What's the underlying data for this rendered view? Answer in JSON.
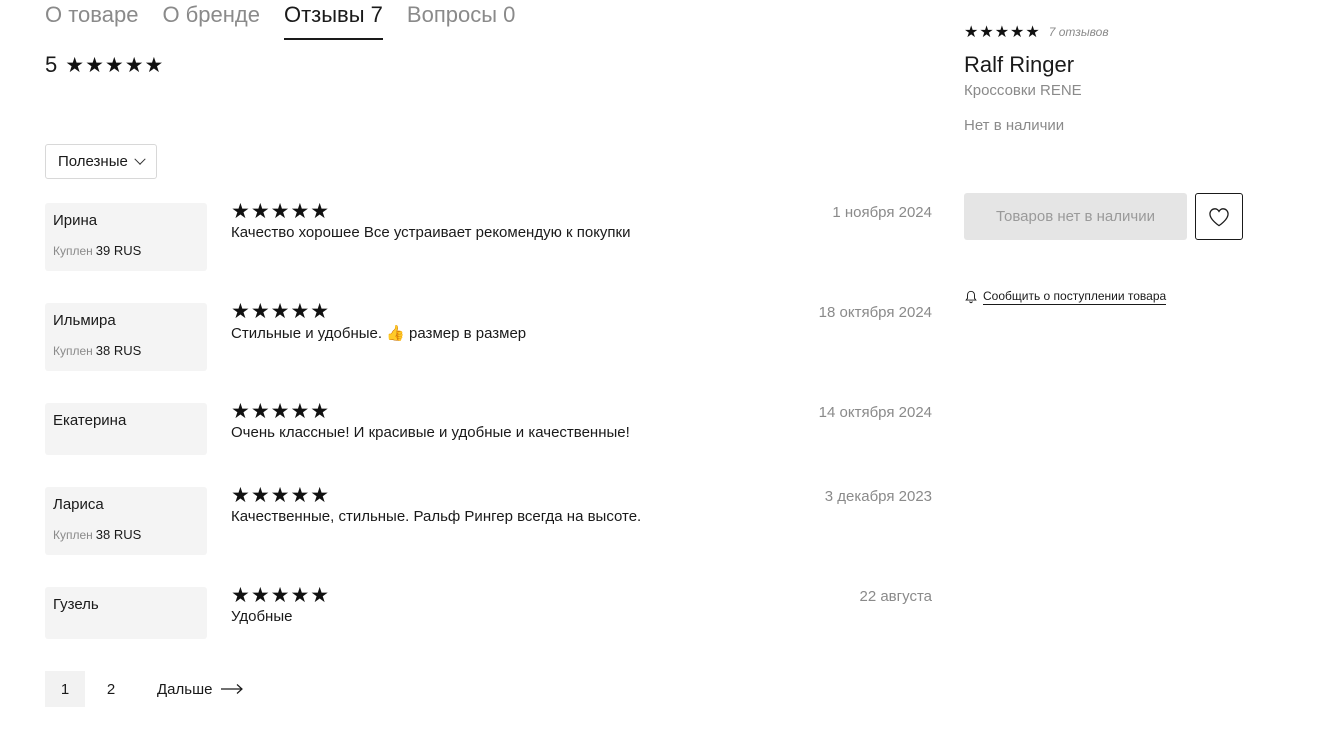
{
  "tabs": [
    {
      "label": "О товаре",
      "active": false
    },
    {
      "label": "О бренде",
      "active": false
    },
    {
      "label": "Отзывы 7",
      "active": true
    },
    {
      "label": "Вопросы 0",
      "active": false
    }
  ],
  "overall": {
    "score": "5",
    "stars": "★★★★★"
  },
  "sort": {
    "label": "Полезные"
  },
  "reviews": [
    {
      "author": "Ирина",
      "bought_label": "Куплен",
      "size": "39 RUS",
      "stars": "★★★★★",
      "text": "Качество хорошее Все устраивает рекомендую к покупки",
      "date": "1 ноября 2024"
    },
    {
      "author": "Ильмира",
      "bought_label": "Куплен",
      "size": "38 RUS",
      "stars": "★★★★★",
      "text": "Стильные и удобные. 👍 размер в размер",
      "date": "18 октября 2024"
    },
    {
      "author": "Екатерина",
      "stars": "★★★★★",
      "text": "Очень классные! И красивые и удобные и качественные!",
      "date": "14 октября 2024"
    },
    {
      "author": "Лариса",
      "bought_label": "Куплен",
      "size": "38 RUS",
      "stars": "★★★★★",
      "text": "Качественные, стильные. Ральф Рингер всегда на высоте.",
      "date": "3 декабря 2023"
    },
    {
      "author": "Гузель",
      "stars": "★★★★★",
      "text": "Удобные",
      "date": "22 августа"
    }
  ],
  "pagination": {
    "pages": [
      "1",
      "2"
    ],
    "current": "1",
    "next_label": "Дальше"
  },
  "product": {
    "stars": "★★★★★",
    "reviews_count": "7 отзывов",
    "brand": "Ralf Ringer",
    "model": "Кроссовки RENE",
    "stock_status": "Нет в наличии",
    "oos_button": "Товаров нет в наличии",
    "notify_label": "Сообщить о поступлении товара"
  },
  "icons": {
    "favorite": "heart-icon",
    "notify": "bell-icon",
    "next": "arrow-right-icon",
    "sort": "chevron-down-icon"
  }
}
